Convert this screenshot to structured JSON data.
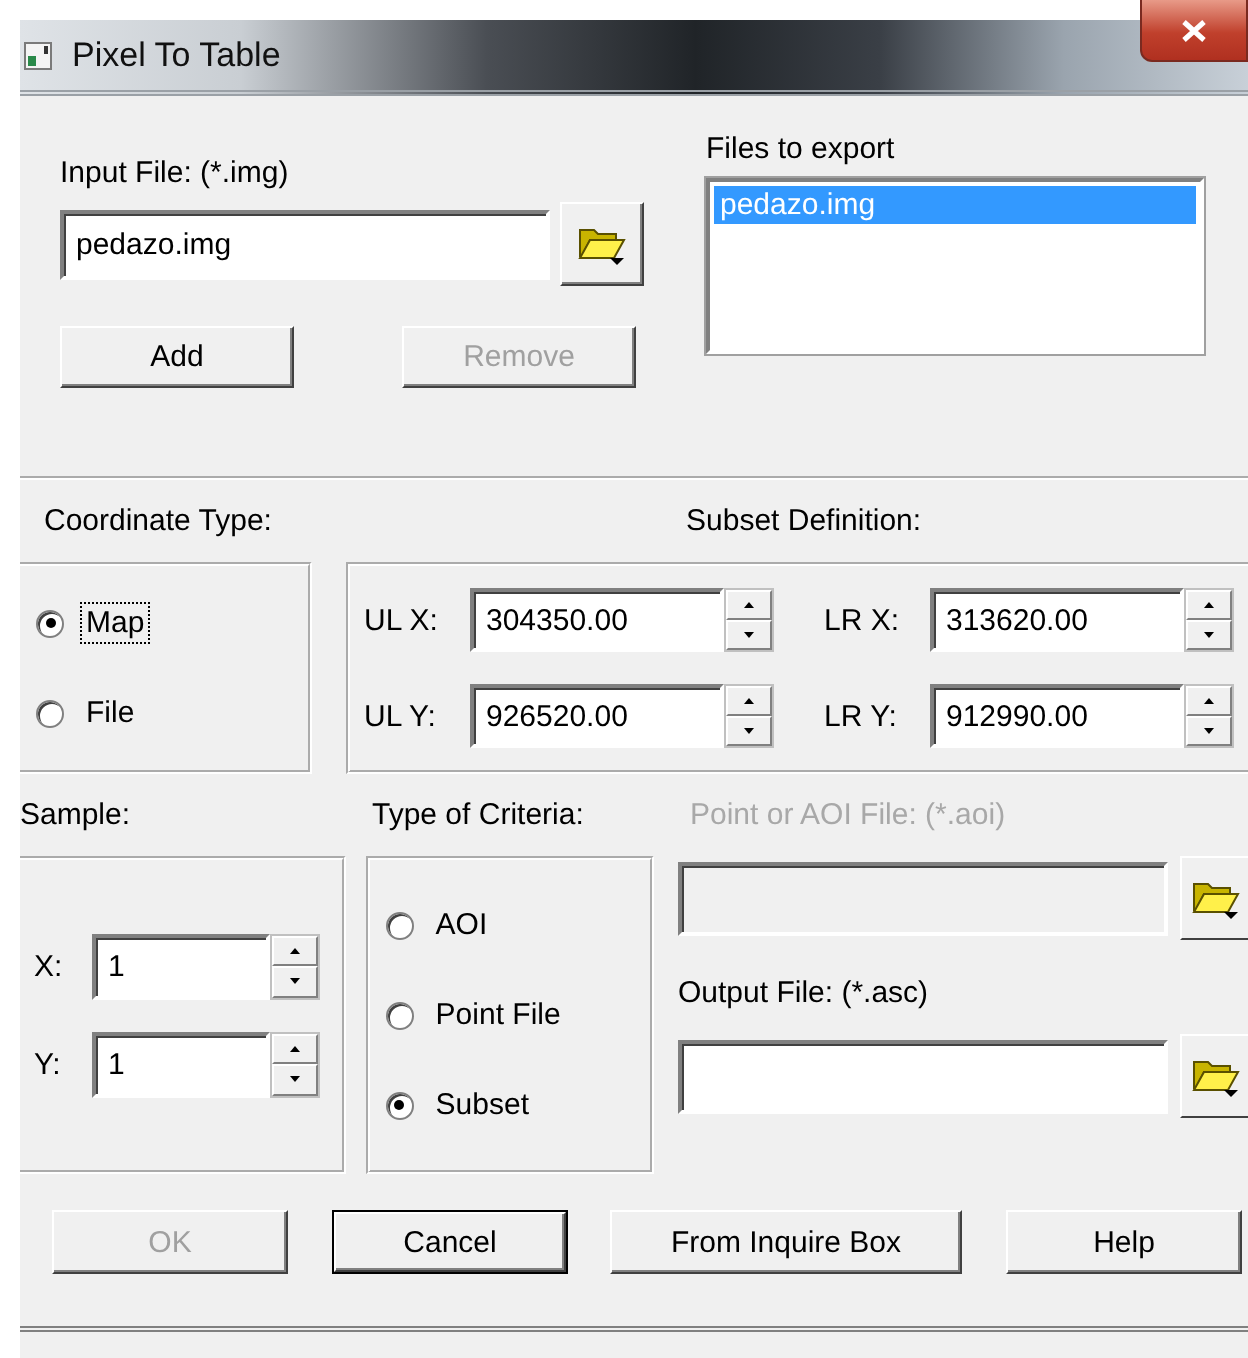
{
  "window": {
    "title": "Pixel To Table"
  },
  "input_file": {
    "label": "Input File: (*.img)",
    "value": "pedazo.img"
  },
  "file_buttons": [
    {
      "label": "Add",
      "disabled": false
    },
    {
      "label": "Remove",
      "disabled": true
    }
  ],
  "files_to_export": {
    "label": "Files to export",
    "items": [
      {
        "text": "pedazo.img",
        "selected": true
      }
    ]
  },
  "coordinate_type": {
    "label": "Coordinate Type:",
    "options": [
      {
        "label": "Map",
        "selected": true,
        "focused": true
      },
      {
        "label": "File",
        "selected": false,
        "focused": false
      }
    ]
  },
  "subset_definition": {
    "label": "Subset Definition:",
    "fields": [
      {
        "label": "UL X:",
        "value": "304350.00"
      },
      {
        "label": "LR X:",
        "value": "313620.00"
      },
      {
        "label": "UL Y:",
        "value": "926520.00"
      },
      {
        "label": "LR Y:",
        "value": "912990.00"
      }
    ]
  },
  "sample": {
    "label": "Sample:",
    "fields": [
      {
        "label": "X:",
        "value": "1"
      },
      {
        "label": "Y:",
        "value": "1"
      }
    ]
  },
  "type_of_criteria": {
    "label": "Type of Criteria:",
    "options": [
      {
        "label": "AOI",
        "selected": false
      },
      {
        "label": "Point File",
        "selected": false
      },
      {
        "label": "Subset",
        "selected": true
      }
    ]
  },
  "aoi_file": {
    "label": "Point or AOI File: (*.aoi)",
    "disabled": true
  },
  "output_file": {
    "label": "Output File: (*.asc)",
    "disabled": false
  },
  "buttons": [
    {
      "label": "OK",
      "disabled": true,
      "default": false
    },
    {
      "label": "Cancel",
      "disabled": false,
      "default": true
    },
    {
      "label": "From Inquire Box",
      "disabled": false,
      "default": false
    },
    {
      "label": "Help",
      "disabled": false,
      "default": false
    }
  ]
}
